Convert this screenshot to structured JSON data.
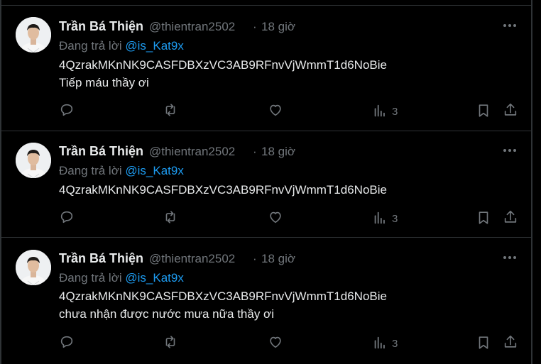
{
  "tweets": [
    {
      "name": "Trần Bá Thiện",
      "handle": "@thientran2502",
      "separator": "·",
      "time": "18 giờ",
      "reply_prefix": "Đang trả lời",
      "reply_mention": "@is_Kat9x",
      "lines": [
        "4QzrakMKnNK9CASFDBXzVC3AB9RFnvVjWmmT1d6NoBie",
        "Tiếp máu thầy ơi"
      ],
      "views": "3"
    },
    {
      "name": "Trần Bá Thiện",
      "handle": "@thientran2502",
      "separator": "·",
      "time": "18 giờ",
      "reply_prefix": "Đang trả lời",
      "reply_mention": "@is_Kat9x",
      "lines": [
        "4QzrakMKnNK9CASFDBXzVC3AB9RFnvVjWmmT1d6NoBie"
      ],
      "views": "3"
    },
    {
      "name": "Trần Bá Thiện",
      "handle": "@thientran2502",
      "separator": "·",
      "time": "18 giờ",
      "reply_prefix": "Đang trả lời",
      "reply_mention": "@is_Kat9x",
      "lines": [
        "4QzrakMKnNK9CASFDBXzVC3AB9RFnvVjWmmT1d6NoBie",
        "chưa nhận được nước mưa nữa thầy ơi"
      ],
      "views": "3"
    }
  ],
  "icons": {
    "more": "more-horizontal-icon",
    "reply": "reply-icon",
    "retweet": "retweet-icon",
    "like": "heart-icon",
    "views": "bar-chart-icon",
    "bookmark": "bookmark-icon",
    "share": "share-icon"
  },
  "colors": {
    "background": "#000000",
    "text": "#e7e9ea",
    "muted": "#71767b",
    "link": "#1d9bf0",
    "divider": "#2f3336"
  }
}
